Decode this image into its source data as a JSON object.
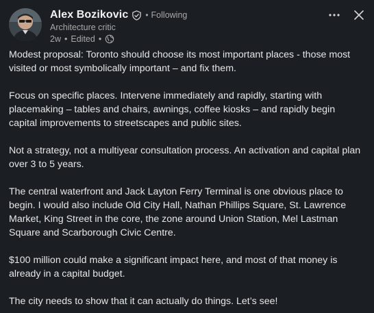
{
  "author": {
    "name": "Alex Bozikovic",
    "relationship": "Following",
    "headline": "Architecture critic",
    "time": "2w",
    "edited": "Edited"
  },
  "icons": {
    "verified": "verified-shield-icon",
    "globe": "globe-icon",
    "more": "more-horizontal-icon",
    "close": "close-icon"
  },
  "post": {
    "paragraphs": [
      "Modest proposal: Toronto should choose its most important places - those most visited or most symbolically important – and fix them.",
      "Focus on specific places. Intervene immediately and rapidly, starting with placemaking – tables and chairs, awnings, coffee kiosks – and rapidly begin capital improvements to streetscapes and public sites.",
      "Not a strategy, not a multiyear consultation process. An activation and capital plan over 3 to 5 years.",
      "The central waterfront and Jack Layton Ferry Terminal is one obvious place to begin. I would also include Old City Hall, Nathan Phillips Square, St. Lawrence Market, King Street in the core, the zone around Union Station, Mel Lastman Square and Scarborough Civic Centre.",
      "$100 million could make a significant impact here, and most of that money is already in a capital budget.",
      "The city needs to show that it can actually do things. Let’s see!"
    ]
  },
  "colors": {
    "background": "#1b1f23",
    "text": "#e6e6e6",
    "muted": "#a8a8a8"
  }
}
